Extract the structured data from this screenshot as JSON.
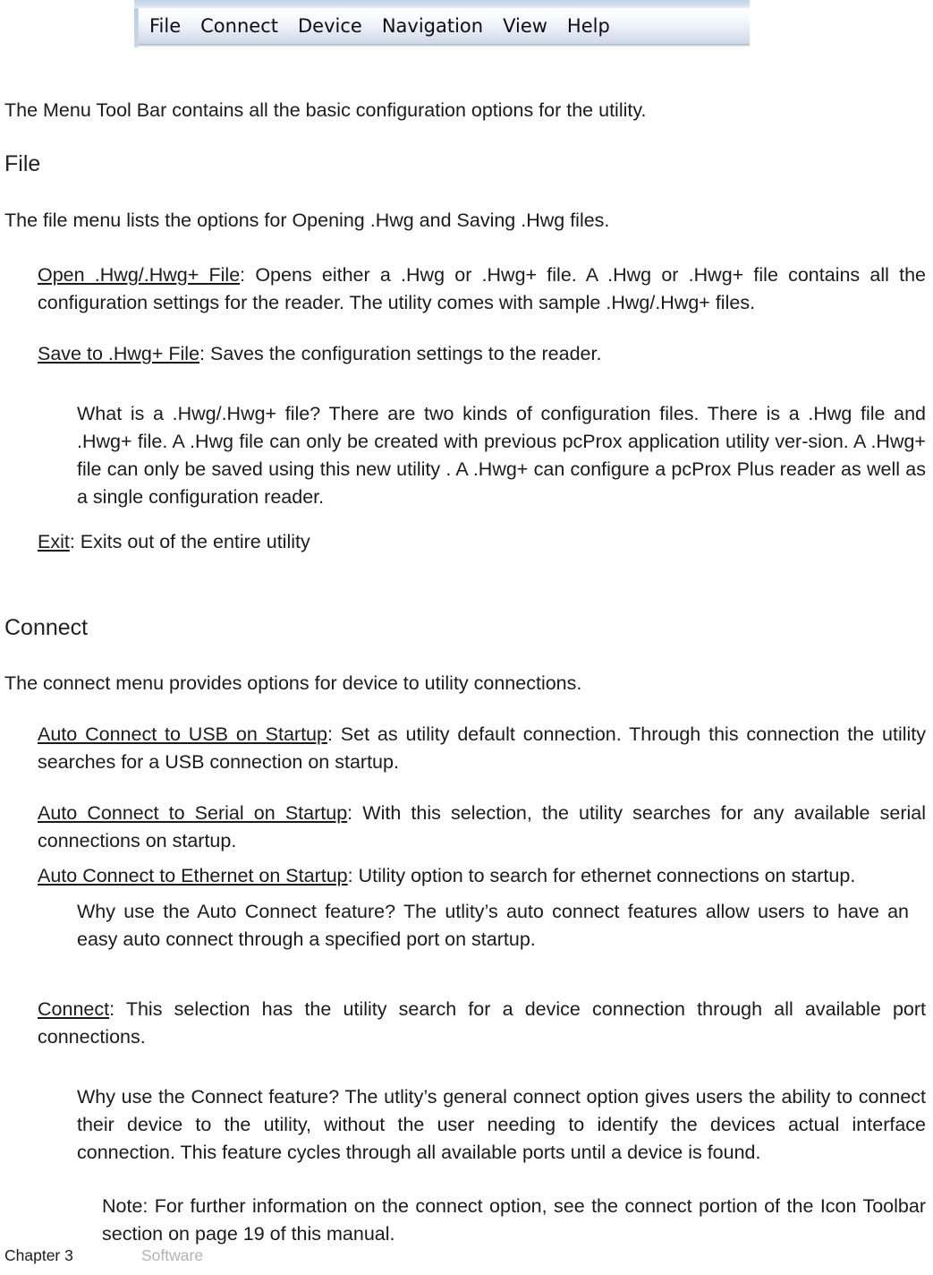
{
  "figure": {
    "name": "menu-tool-bar-screenshot",
    "ghost_text": "· ·      · ·         — · ·       ·",
    "menu_items": [
      {
        "label": "File"
      },
      {
        "label": "Connect"
      },
      {
        "label": "Device"
      },
      {
        "label": "Navigation"
      },
      {
        "label": "View"
      },
      {
        "label": "Help"
      }
    ]
  },
  "content": {
    "intro": "The Menu  Tool  Bar contains  all the basic configuration  options for the utility.",
    "heading_file": "File",
    "file_intro": "The file menu lists the options for Opening  .Hwg  and Saving .Hwg files.",
    "open_term": "Open .Hwg/.Hwg+ File",
    "open_body": ": Opens either  a .Hwg  or .Hwg+ file.  A .Hwg or .Hwg+ file contains all the configuration settings for the reader. The utility comes with sample .Hwg/.Hwg+ files.",
    "save_term": "Save to .Hwg+  File",
    "save_body": ": Saves the configuration settings to the reader.",
    "hwg_explainer": "What is a .Hwg/.Hwg+  file?  There are two kinds of configuration  files. There is a .Hwg  file and .Hwg+ file. A .Hwg file can only be created with previous pcProx application  utility ver-sion. A .Hwg+ file can only be saved using this new utility . A .Hwg+  can configure  a pcProx Plus reader  as well as a single configuration   reader.",
    "exit_term": "Exit",
    "exit_body": ": Exits out of the entire utility",
    "heading_connect": "Connect",
    "connect_intro": "The connect menu provides options for device to utility connections.",
    "usb_term": "Auto Connect to USB on Startup",
    "usb_body": ":  Set as utility default connection. Through this connection the utility searches for a USB connection on startup.",
    "serial_term": "Auto Connect to Serial on Startup",
    "serial_body": ": With  this selection, the utility searches for any available serial connections on startup.",
    "ethernet_term": "Auto Connect to Ethernet on Startup",
    "ethernet_body": ":  Utility option to search for ethernet connections on startup.",
    "why_auto_connect": "Why use the Auto Connect feature? The utlity’s auto connect features allow users to have an easy auto connect  through  a specified port on startup.",
    "connect_term": "Connect",
    "connect_body": ": This selection has the utility search for a device connection  through  all available port connections.",
    "why_connect": "Why use the Connect feature? The utlity’s general connect option  gives users the ability to connect their device to the utility, without the user needing to identify the devices actual interface connection. This feature cycles through  all available ports until a device is found.",
    "note": "Note: For further  information  on the connect  option,  see the connect portion of the Icon Toolbar  section  on page 19 of this manual."
  },
  "footer": {
    "chapter": "Chapter 3",
    "section": "Software"
  }
}
